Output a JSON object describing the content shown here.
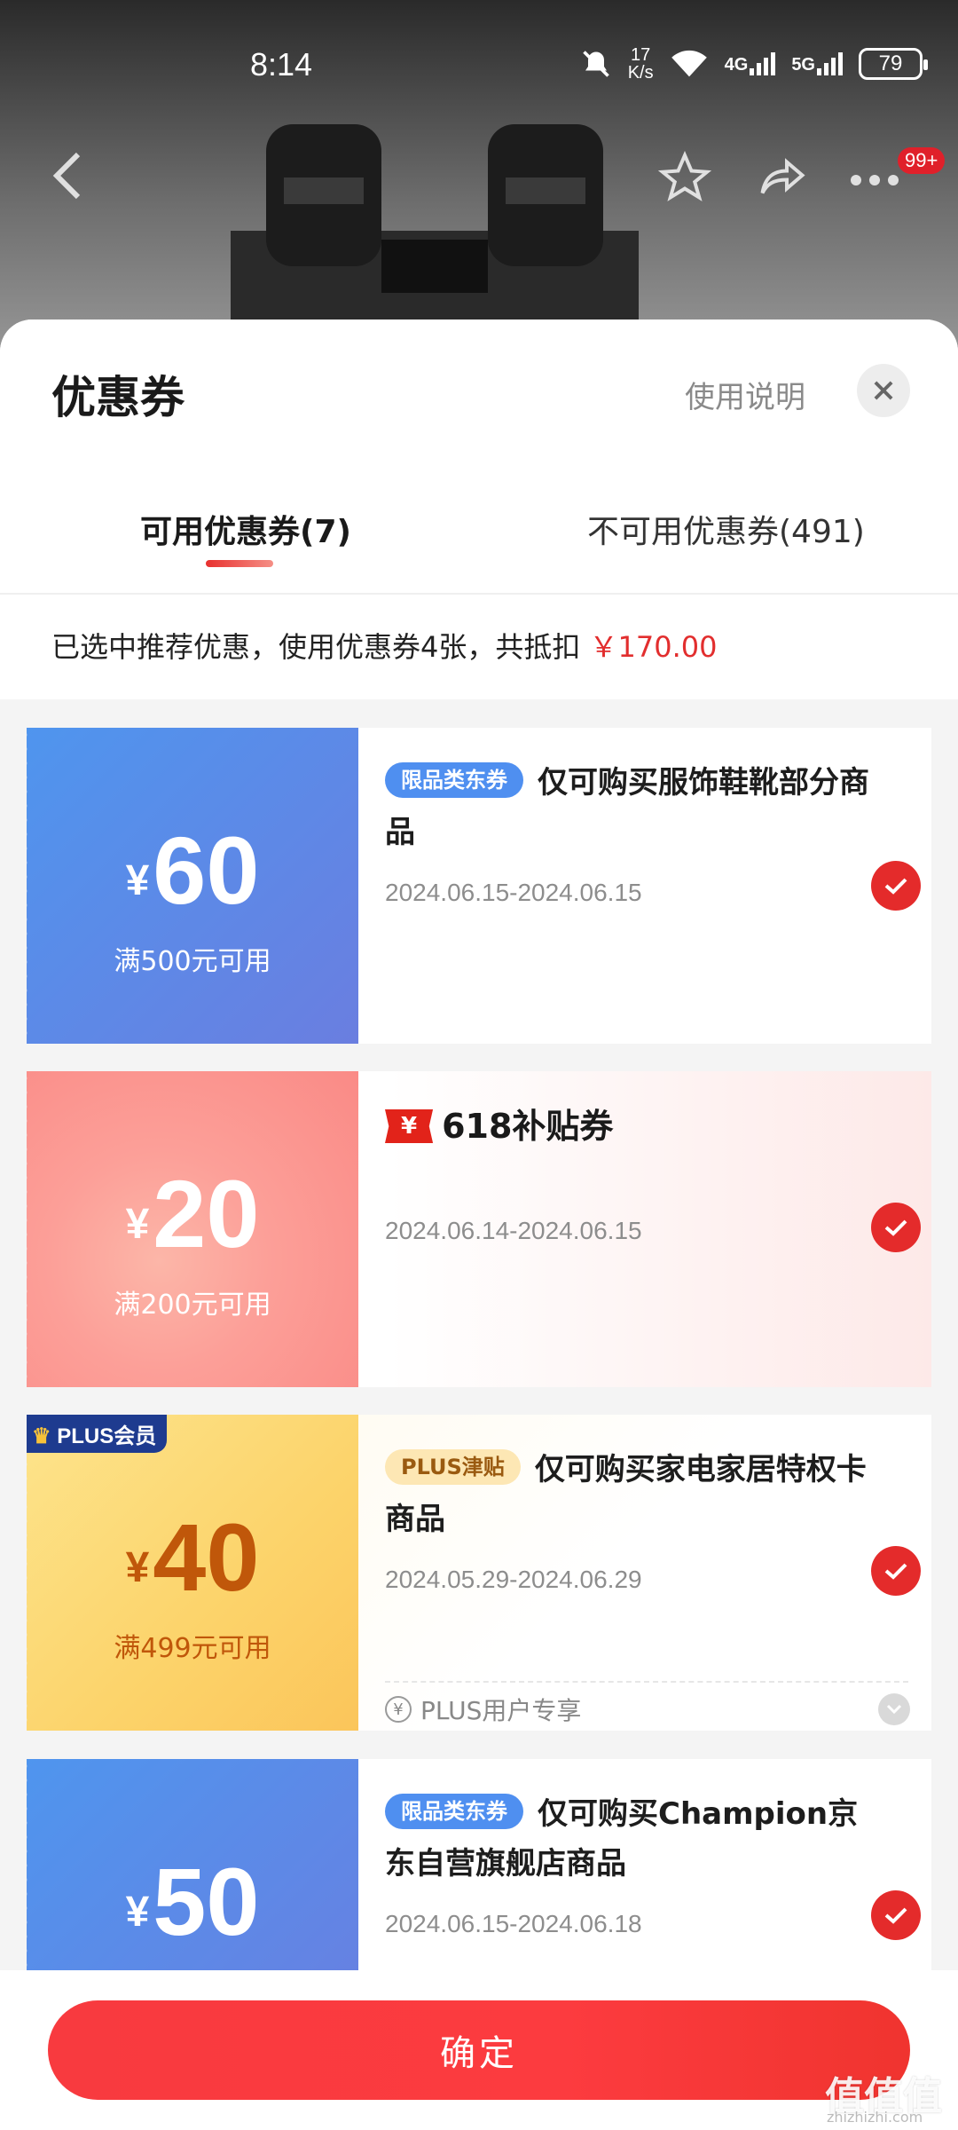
{
  "status_bar": {
    "time": "8:14",
    "speed_value": "17",
    "speed_unit": "K/s",
    "net1": "4G",
    "net2": "5G",
    "battery": "79"
  },
  "topbar": {
    "badge": "99+"
  },
  "sheet": {
    "title": "优惠券",
    "help": "使用说明",
    "tabs": [
      {
        "label": "可用优惠券(7)"
      },
      {
        "label": "不可用优惠券(491)"
      }
    ],
    "summary_text": "已选中推荐优惠，使用优惠券4张，共抵扣",
    "summary_amount": "￥170.00"
  },
  "coupons": [
    {
      "currency": "¥",
      "amount": "60",
      "condition": "满500元可用",
      "tag": "限品类东券",
      "text": "仅可购买服饰鞋靴部分商品",
      "date": "2024.06.15-2024.06.15"
    },
    {
      "currency": "¥",
      "amount": "20",
      "condition": "满200元可用",
      "brand_icon": "¥",
      "brand_text": "618补贴券",
      "date": "2024.06.14-2024.06.15"
    },
    {
      "badge": "PLUS会员",
      "currency": "¥",
      "amount": "40",
      "condition": "满499元可用",
      "tag": "PLUS津贴",
      "text": "仅可购买家电家居特权卡商品",
      "date": "2024.05.29-2024.06.29",
      "footer_icon": "¥",
      "footer": "PLUS用户专享"
    },
    {
      "currency": "¥",
      "amount": "50",
      "condition": "",
      "tag": "限品类东券",
      "text": "仅可购买Champion京东自营旗舰店商品",
      "date": "2024.06.15-2024.06.18"
    }
  ],
  "confirm_label": "确定",
  "watermark": "值值值",
  "watermark_sub": "zhizhizhi.com",
  "colors": {
    "accent": "#e42b2b",
    "blue_coupon": "#5b86e6",
    "pink_coupon": "#fc9f98",
    "gold_coupon": "#fcd36a"
  }
}
